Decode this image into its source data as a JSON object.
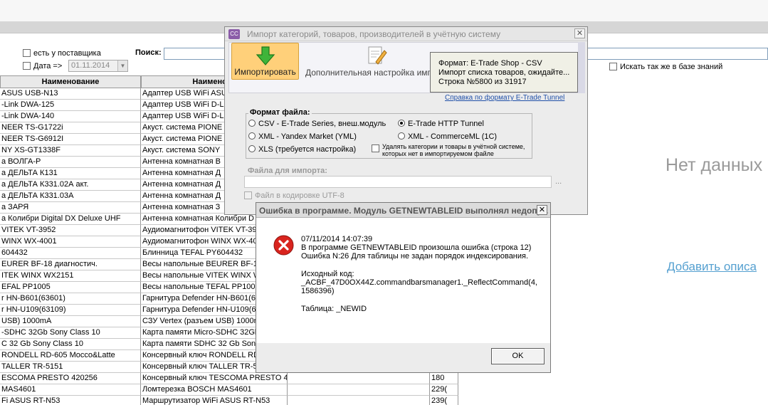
{
  "filters": {
    "supplier_label": "есть у поставщика",
    "date_label": "Дата =>",
    "date_value": "01.11.2014",
    "search_label": "Поиск:",
    "knowledge_base_label": "Искать так же в базе знаний"
  },
  "grid": {
    "col1_header": "Наименование",
    "col2_header": "Наименова",
    "rows": [
      {
        "c1": "ASUS USB-N13",
        "c2": "Адаптер USB WiFi ASUS",
        "c4": ""
      },
      {
        "c1": "-Link DWA-125",
        "c2": "Адаптер USB WiFi D-Li",
        "c4": ""
      },
      {
        "c1": "-Link DWA-140",
        "c2": "Адаптер USB WiFi D-Li",
        "c4": ""
      },
      {
        "c1": "NEER TS-G1722i",
        "c2": "Акуст. система PIONE",
        "c4": ""
      },
      {
        "c1": "NEER TS-G6912I",
        "c2": "Акуст. система PIONE",
        "c4": ""
      },
      {
        "c1": "NY XS-GT1338F",
        "c2": "Акуст. система SONY",
        "c4": ""
      },
      {
        "c1": "а ВОЛГА-Р",
        "c2": "Антенна комнатная В",
        "c4": ""
      },
      {
        "c1": "а ДЕЛЬТА К131",
        "c2": "Антенна комнатная Д",
        "c4": ""
      },
      {
        "c1": "а ДЕЛЬТА К331.02А акт.",
        "c2": "Антенна комнатная Д",
        "c4": ""
      },
      {
        "c1": "а ДЕЛЬТА К331.03А",
        "c2": "Антенна комнатная Д",
        "c4": ""
      },
      {
        "c1": "а ЗАРЯ",
        "c2": "Антенна комнатная З",
        "c4": ""
      },
      {
        "c1": "а Колибри Digital DX Deluxe UHF",
        "c2": "Антенна комнатная Колибри D",
        "c4": ""
      },
      {
        "c1": "VITEK VT-3952",
        "c2": "Аудиомагнитофон VITEK VT-39",
        "c4": ""
      },
      {
        "c1": "WINX WX-4001",
        "c2": "Аудиомагнитофон WINX WX-40",
        "c4": ""
      },
      {
        "c1": "604432",
        "c2": "Блинница TEFAL PY604432",
        "c4": ""
      },
      {
        "c1": "EURER BF-18 диагностич.",
        "c2": "Весы напольные BEURER BF-18",
        "c4": ""
      },
      {
        "c1": "ITEK WINX WX2151",
        "c2": "Весы напольные VITEK WINX W",
        "c4": ""
      },
      {
        "c1": "EFAL PP1005",
        "c2": "Весы напольные TEFAL PP1005",
        "c4": ""
      },
      {
        "c1": "r HN-B601(63601)",
        "c2": "Гарнитура Defender HN-B601(6",
        "c4": ""
      },
      {
        "c1": "r HN-U109(63109)",
        "c2": "Гарнитура Defender HN-U109(6",
        "c4": ""
      },
      {
        "c1": "USB) 1000mA",
        "c2": "СЗУ Vertex (разъем USB) 1000m",
        "c4": ""
      },
      {
        "c1": "-SDHC 32Gb Sony Class 10",
        "c2": "Карта памяти Micro-SDHC 32Gb",
        "c4": ""
      },
      {
        "c1": "С 32 Gb Sony Class 10",
        "c2": "Карта памяти SDHC 32 Gb Sony",
        "c4": ""
      },
      {
        "c1": "RONDELL RD-605 Mocco&Latte",
        "c2": "Консервный ключ RONDELL RD",
        "c4": ""
      },
      {
        "c1": "TALLER TR-5151",
        "c2": "Консервный ключ TALLER TR-5",
        "c4": ""
      },
      {
        "c1": "ESCOMA PRESTO 420256",
        "c2": "Консервный ключ TESCOMA PRESTO 42",
        "c4": "180"
      },
      {
        "c1": "MAS4601",
        "c2": "Ломтерезка BOSCH MAS4601",
        "c4": "229("
      },
      {
        "c1": "Fi ASUS RT-N53",
        "c2": "Маршрутизатор WiFi ASUS RT-N53",
        "c4": "239("
      }
    ]
  },
  "right_panel": {
    "no_data": "Нет данных",
    "add_description": "Добавить описа"
  },
  "import_window": {
    "title": "Импорт категорий, товаров, производителей в учётную систему",
    "app_icon": "CC",
    "import_button": "Импортировать",
    "advanced_button": "Дополнительная настройка имп",
    "format_link": "Справка по формату E-Trade Tunnel",
    "format_group_label": "Формат файла:",
    "options": {
      "csv": "CSV - E-Trade Series, внеш.модуль",
      "yml": "XML - Yandex Market (YML)",
      "xls": "XLS (требуется настройка)",
      "http_tunnel": "E-Trade HTTP Tunnel",
      "commerceml": "XML - CommerceML (1С)",
      "delete_missing": "Удалять категории и товары в учётной системе, которых нет в импортируемом файле"
    },
    "selected_format": "E-Trade HTTP Tunnel",
    "file_label": "Файла для импорта:",
    "file_value": "",
    "browse": "...",
    "utf8_label": "Файл в кодировке UTF-8"
  },
  "tooltip": {
    "line1": "Формат: E-Trade Shop - CSV",
    "line2": "Импорт списка товаров, ожидайте...",
    "line3": "Строка №5800 из 31917"
  },
  "error_dialog": {
    "title": "Ошибка в программе. Модуль GETNEWTABLEID выполнял недопу...",
    "timestamp": "07/11/2014 14:07:39",
    "line1": "В программе GETNEWTABLEID произошла ошибка (строка 12)",
    "line2": "Ошибка N:26 Для таблицы не задан порядок индексирования.",
    "source_label": "Исходный код:",
    "source_code": "_ACBF_47D0OX44Z.commandbarsmanager1._ReflectCommand(4, 1586396)",
    "table_line": "Таблица: _NEWID",
    "ok": "OK"
  }
}
